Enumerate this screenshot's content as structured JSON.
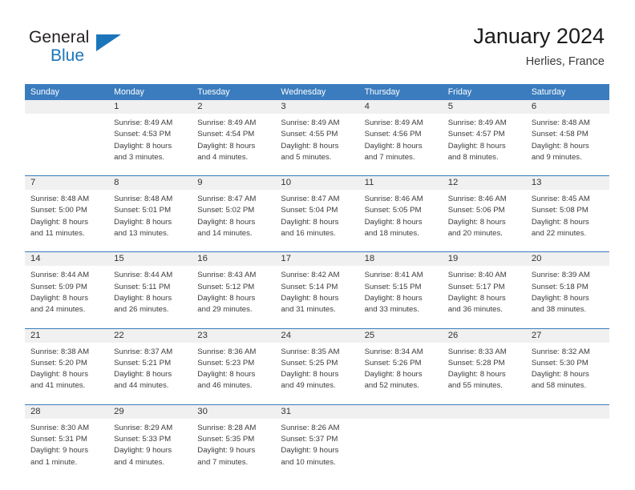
{
  "logo": {
    "word1": "General",
    "word2": "Blue",
    "triangle_color": "#1b75bb",
    "icon": "general-blue-logo"
  },
  "header": {
    "title": "January 2024",
    "subtitle": "Herlies, France"
  },
  "calendar": {
    "accent_color": "#3a7cbe",
    "daynum_band_color": "#f0f0f0",
    "weekdays": [
      "Sunday",
      "Monday",
      "Tuesday",
      "Wednesday",
      "Thursday",
      "Friday",
      "Saturday"
    ],
    "weeks": [
      [
        {
          "day": "",
          "lines": [
            "",
            "",
            "",
            ""
          ]
        },
        {
          "day": "1",
          "lines": [
            "Sunrise: 8:49 AM",
            "Sunset: 4:53 PM",
            "Daylight: 8 hours",
            "and 3 minutes."
          ]
        },
        {
          "day": "2",
          "lines": [
            "Sunrise: 8:49 AM",
            "Sunset: 4:54 PM",
            "Daylight: 8 hours",
            "and 4 minutes."
          ]
        },
        {
          "day": "3",
          "lines": [
            "Sunrise: 8:49 AM",
            "Sunset: 4:55 PM",
            "Daylight: 8 hours",
            "and 5 minutes."
          ]
        },
        {
          "day": "4",
          "lines": [
            "Sunrise: 8:49 AM",
            "Sunset: 4:56 PM",
            "Daylight: 8 hours",
            "and 7 minutes."
          ]
        },
        {
          "day": "5",
          "lines": [
            "Sunrise: 8:49 AM",
            "Sunset: 4:57 PM",
            "Daylight: 8 hours",
            "and 8 minutes."
          ]
        },
        {
          "day": "6",
          "lines": [
            "Sunrise: 8:48 AM",
            "Sunset: 4:58 PM",
            "Daylight: 8 hours",
            "and 9 minutes."
          ]
        }
      ],
      [
        {
          "day": "7",
          "lines": [
            "Sunrise: 8:48 AM",
            "Sunset: 5:00 PM",
            "Daylight: 8 hours",
            "and 11 minutes."
          ]
        },
        {
          "day": "8",
          "lines": [
            "Sunrise: 8:48 AM",
            "Sunset: 5:01 PM",
            "Daylight: 8 hours",
            "and 13 minutes."
          ]
        },
        {
          "day": "9",
          "lines": [
            "Sunrise: 8:47 AM",
            "Sunset: 5:02 PM",
            "Daylight: 8 hours",
            "and 14 minutes."
          ]
        },
        {
          "day": "10",
          "lines": [
            "Sunrise: 8:47 AM",
            "Sunset: 5:04 PM",
            "Daylight: 8 hours",
            "and 16 minutes."
          ]
        },
        {
          "day": "11",
          "lines": [
            "Sunrise: 8:46 AM",
            "Sunset: 5:05 PM",
            "Daylight: 8 hours",
            "and 18 minutes."
          ]
        },
        {
          "day": "12",
          "lines": [
            "Sunrise: 8:46 AM",
            "Sunset: 5:06 PM",
            "Daylight: 8 hours",
            "and 20 minutes."
          ]
        },
        {
          "day": "13",
          "lines": [
            "Sunrise: 8:45 AM",
            "Sunset: 5:08 PM",
            "Daylight: 8 hours",
            "and 22 minutes."
          ]
        }
      ],
      [
        {
          "day": "14",
          "lines": [
            "Sunrise: 8:44 AM",
            "Sunset: 5:09 PM",
            "Daylight: 8 hours",
            "and 24 minutes."
          ]
        },
        {
          "day": "15",
          "lines": [
            "Sunrise: 8:44 AM",
            "Sunset: 5:11 PM",
            "Daylight: 8 hours",
            "and 26 minutes."
          ]
        },
        {
          "day": "16",
          "lines": [
            "Sunrise: 8:43 AM",
            "Sunset: 5:12 PM",
            "Daylight: 8 hours",
            "and 29 minutes."
          ]
        },
        {
          "day": "17",
          "lines": [
            "Sunrise: 8:42 AM",
            "Sunset: 5:14 PM",
            "Daylight: 8 hours",
            "and 31 minutes."
          ]
        },
        {
          "day": "18",
          "lines": [
            "Sunrise: 8:41 AM",
            "Sunset: 5:15 PM",
            "Daylight: 8 hours",
            "and 33 minutes."
          ]
        },
        {
          "day": "19",
          "lines": [
            "Sunrise: 8:40 AM",
            "Sunset: 5:17 PM",
            "Daylight: 8 hours",
            "and 36 minutes."
          ]
        },
        {
          "day": "20",
          "lines": [
            "Sunrise: 8:39 AM",
            "Sunset: 5:18 PM",
            "Daylight: 8 hours",
            "and 38 minutes."
          ]
        }
      ],
      [
        {
          "day": "21",
          "lines": [
            "Sunrise: 8:38 AM",
            "Sunset: 5:20 PM",
            "Daylight: 8 hours",
            "and 41 minutes."
          ]
        },
        {
          "day": "22",
          "lines": [
            "Sunrise: 8:37 AM",
            "Sunset: 5:21 PM",
            "Daylight: 8 hours",
            "and 44 minutes."
          ]
        },
        {
          "day": "23",
          "lines": [
            "Sunrise: 8:36 AM",
            "Sunset: 5:23 PM",
            "Daylight: 8 hours",
            "and 46 minutes."
          ]
        },
        {
          "day": "24",
          "lines": [
            "Sunrise: 8:35 AM",
            "Sunset: 5:25 PM",
            "Daylight: 8 hours",
            "and 49 minutes."
          ]
        },
        {
          "day": "25",
          "lines": [
            "Sunrise: 8:34 AM",
            "Sunset: 5:26 PM",
            "Daylight: 8 hours",
            "and 52 minutes."
          ]
        },
        {
          "day": "26",
          "lines": [
            "Sunrise: 8:33 AM",
            "Sunset: 5:28 PM",
            "Daylight: 8 hours",
            "and 55 minutes."
          ]
        },
        {
          "day": "27",
          "lines": [
            "Sunrise: 8:32 AM",
            "Sunset: 5:30 PM",
            "Daylight: 8 hours",
            "and 58 minutes."
          ]
        }
      ],
      [
        {
          "day": "28",
          "lines": [
            "Sunrise: 8:30 AM",
            "Sunset: 5:31 PM",
            "Daylight: 9 hours",
            "and 1 minute."
          ]
        },
        {
          "day": "29",
          "lines": [
            "Sunrise: 8:29 AM",
            "Sunset: 5:33 PM",
            "Daylight: 9 hours",
            "and 4 minutes."
          ]
        },
        {
          "day": "30",
          "lines": [
            "Sunrise: 8:28 AM",
            "Sunset: 5:35 PM",
            "Daylight: 9 hours",
            "and 7 minutes."
          ]
        },
        {
          "day": "31",
          "lines": [
            "Sunrise: 8:26 AM",
            "Sunset: 5:37 PM",
            "Daylight: 9 hours",
            "and 10 minutes."
          ]
        },
        {
          "day": "",
          "lines": [
            "",
            "",
            "",
            ""
          ]
        },
        {
          "day": "",
          "lines": [
            "",
            "",
            "",
            ""
          ]
        },
        {
          "day": "",
          "lines": [
            "",
            "",
            "",
            ""
          ]
        }
      ]
    ]
  }
}
